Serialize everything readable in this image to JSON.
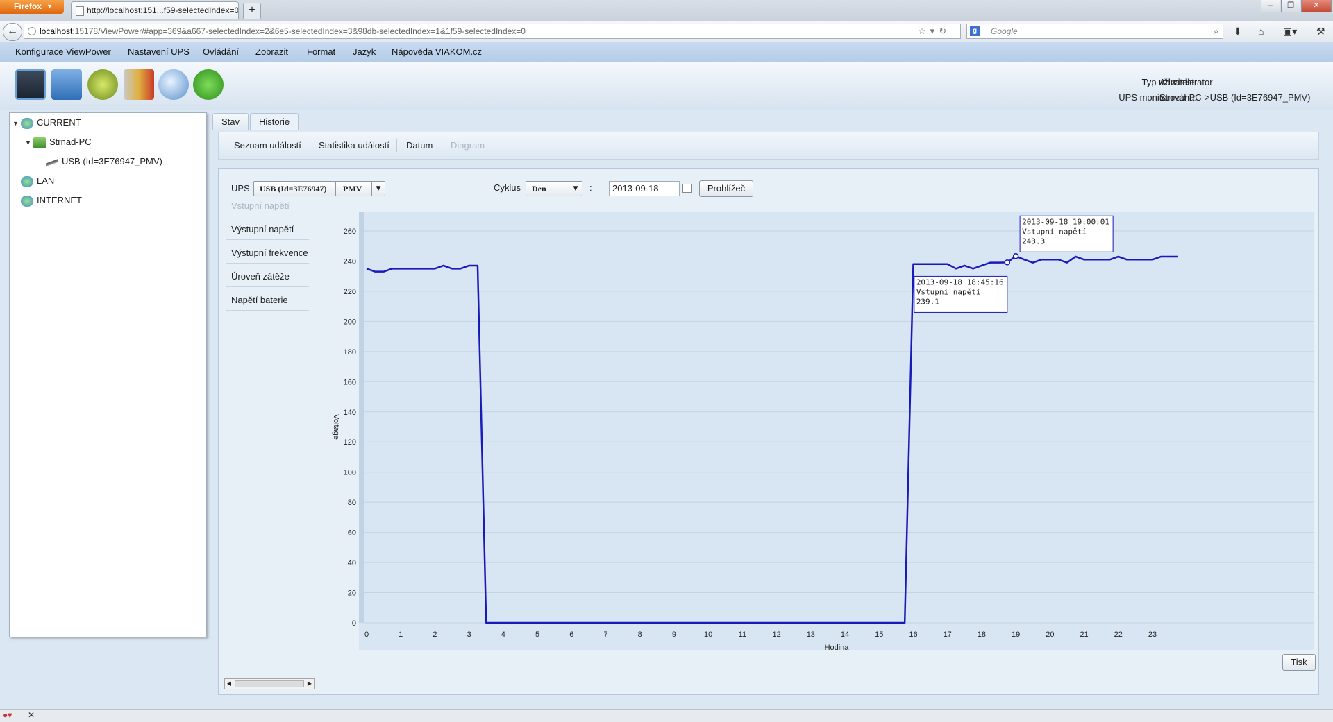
{
  "browser": {
    "menu_button": "Firefox",
    "tab_title": "http://localhost:151...f59-selectedIndex=0",
    "new_tab": "+",
    "url_host": "localhost",
    "url_rest": ":15178/ViewPower/#app=369&a667-selectedIndex=2&6e5-selectedIndex=3&98db-selectedIndex=1&1f59-selectedIndex=0",
    "search_placeholder": "Google"
  },
  "menu": [
    "Konfigurace ViewPower",
    "Nastavení UPS",
    "Ovládání",
    "Zobrazit",
    "Format",
    "Jazyk",
    "Nápověda VIAKOM.cz"
  ],
  "user_info": {
    "user_type_label": "Typ uživatele:",
    "user_type_value": "Administrator",
    "ups_label": "UPS monitorována:",
    "ups_value": "Strnad-PC->USB (Id=3E76947_PMV)"
  },
  "tree": {
    "current": "CURRENT",
    "pc": "Strnad-PC",
    "usb": "USB (Id=3E76947_PMV)",
    "lan": "LAN",
    "internet": "INTERNET"
  },
  "tabs": [
    "Stav",
    "Historie"
  ],
  "subnav": [
    "Seznam událostí",
    "Statistika událostí",
    "Datum",
    "Diagram"
  ],
  "controls": {
    "ups_label": "UPS",
    "ups_select": "USB (Id=3E76947)",
    "pmv_select": "PMV",
    "cycle_label": "Cyklus",
    "cycle_select": "Den",
    "colon": ":",
    "date_value": "2013-09-18",
    "browse_button": "Prohlížeč",
    "print_button": "Tisk"
  },
  "series_menu": [
    "Vstupní napětí",
    "Výstupní napětí",
    "Výstupní frekvence",
    "Úroveň zátěže",
    "Napětí baterie"
  ],
  "colors": {
    "line": "#1a1ab8",
    "plot_bg": "#d8e6f3",
    "grid": "#c2d3e4"
  },
  "chart_data": {
    "type": "line",
    "xlabel": "Hodina",
    "ylabel": "Voltage",
    "xlim": [
      0,
      23.75
    ],
    "ylim": [
      0,
      260
    ],
    "x_ticks": [
      0,
      1,
      2,
      3,
      4,
      5,
      6,
      7,
      8,
      9,
      10,
      11,
      12,
      13,
      14,
      15,
      16,
      17,
      18,
      19,
      20,
      21,
      22,
      23
    ],
    "y_ticks": [
      0,
      20,
      40,
      60,
      80,
      100,
      120,
      140,
      160,
      180,
      200,
      220,
      240,
      260
    ],
    "series": [
      {
        "name": "Vstupní napětí",
        "x": [
          0,
          0.25,
          0.5,
          0.75,
          1,
          1.5,
          2,
          2.25,
          2.5,
          2.75,
          3,
          3.25,
          3.5,
          15.75,
          16,
          16.5,
          17,
          17.25,
          17.5,
          17.75,
          18,
          18.25,
          18.5,
          18.75,
          19,
          19.25,
          19.5,
          19.75,
          20,
          20.25,
          20.5,
          20.75,
          21,
          21.25,
          21.5,
          21.75,
          22,
          22.25,
          22.5,
          22.75,
          23,
          23.25,
          23.5,
          23.75
        ],
        "y": [
          235,
          233,
          233,
          235,
          235,
          235,
          235,
          237,
          235,
          235,
          237,
          237,
          0,
          0,
          238,
          238,
          238,
          235,
          237,
          235,
          237,
          239,
          239,
          239.1,
          243.3,
          241,
          239,
          241,
          241,
          241,
          239,
          243,
          241,
          241,
          241,
          241,
          243,
          241,
          241,
          241,
          241,
          243,
          243,
          243
        ]
      }
    ],
    "tooltips": [
      {
        "time": "2013-09-18 18:45:16",
        "series": "Vstupní napětí",
        "value": "239.1",
        "x": 18.75,
        "y": 239.1
      },
      {
        "time": "2013-09-18 19:00:01",
        "series": "Vstupní napětí",
        "value": "243.3",
        "x": 19,
        "y": 243.3
      }
    ]
  }
}
